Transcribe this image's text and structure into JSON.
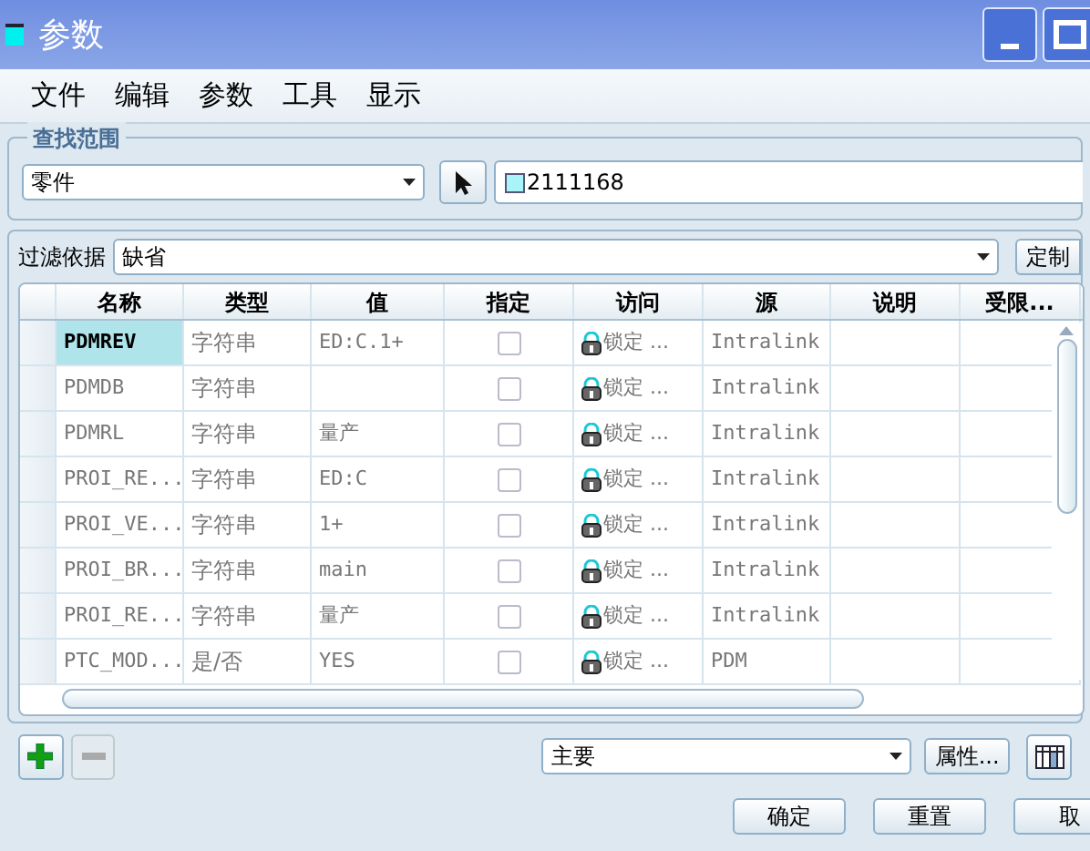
{
  "window": {
    "title": "参数"
  },
  "menu": [
    "文件",
    "编辑",
    "参数",
    "工具",
    "显示"
  ],
  "lookup": {
    "legend": "查找范围",
    "scope": "零件",
    "model": "2111168"
  },
  "filter": {
    "label": "过滤依据",
    "value": "缺省",
    "button": "定制"
  },
  "table": {
    "columns": [
      "名称",
      "类型",
      "值",
      "指定",
      "访问",
      "源",
      "说明",
      "受限..."
    ],
    "rows": [
      {
        "name": "PDMREV",
        "type": "字符串",
        "value": "ED:C.1+",
        "designated": false,
        "access": "锁定 ...",
        "source": "Intralink",
        "selected": true
      },
      {
        "name": "PDMDB",
        "type": "字符串",
        "value": "",
        "designated": false,
        "access": "锁定 ...",
        "source": "Intralink",
        "selected": false
      },
      {
        "name": "PDMRL",
        "type": "字符串",
        "value": "量产",
        "designated": false,
        "access": "锁定 ...",
        "source": "Intralink",
        "selected": false
      },
      {
        "name": "PROI_RE...",
        "type": "字符串",
        "value": "ED:C",
        "designated": false,
        "access": "锁定 ...",
        "source": "Intralink",
        "selected": false
      },
      {
        "name": "PROI_VE...",
        "type": "字符串",
        "value": "1+",
        "designated": false,
        "access": "锁定 ...",
        "source": "Intralink",
        "selected": false
      },
      {
        "name": "PROI_BR...",
        "type": "字符串",
        "value": "main",
        "designated": false,
        "access": "锁定 ...",
        "source": "Intralink",
        "selected": false
      },
      {
        "name": "PROI_RE...",
        "type": "字符串",
        "value": "量产",
        "designated": false,
        "access": "锁定 ...",
        "source": "Intralink",
        "selected": false
      },
      {
        "name": "PTC_MOD...",
        "type": "是/否",
        "value": "YES",
        "designated": false,
        "access": "锁定 ...",
        "source": "PDM",
        "selected": false
      }
    ]
  },
  "toolbar": {
    "add_disabled": false,
    "remove_disabled": true,
    "view": "主要",
    "properties": "属性..."
  },
  "buttons": [
    "确定",
    "重置",
    "取"
  ]
}
